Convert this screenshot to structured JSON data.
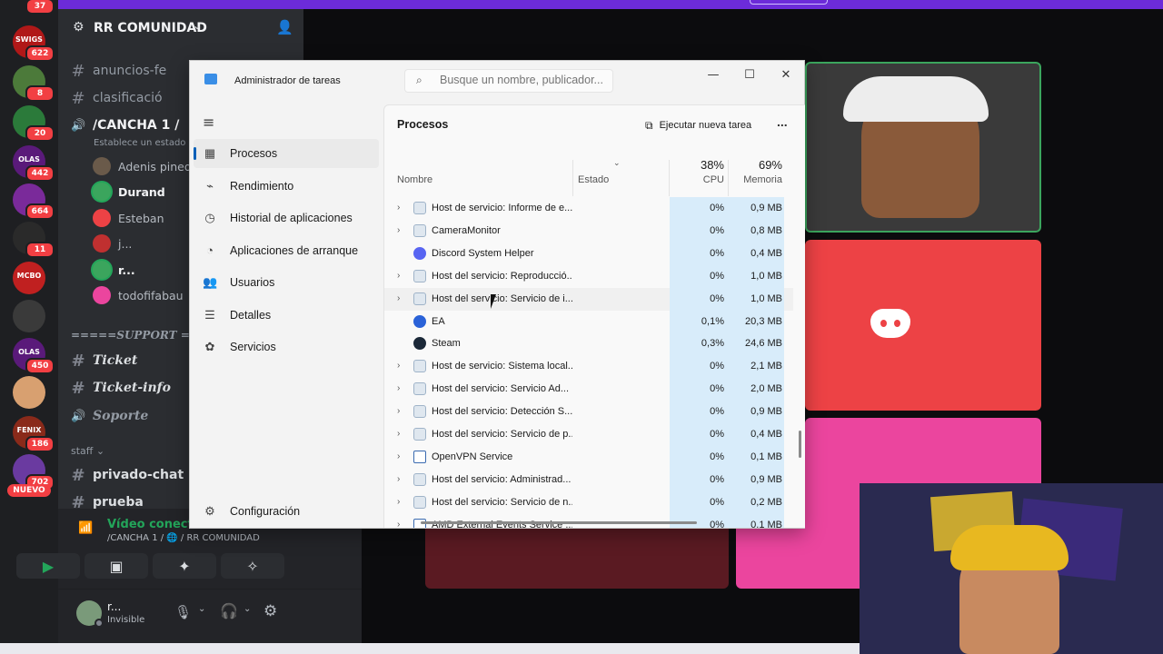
{
  "rail": {
    "top_badge": "37",
    "servers": [
      {
        "label": "SWIGS",
        "badge": "622",
        "color": "#b01818"
      },
      {
        "label": "",
        "badge": "8",
        "color": "#4c7a3a"
      },
      {
        "label": "",
        "badge": "20",
        "color": "#2b7a3a"
      },
      {
        "label": "OLAS",
        "badge": "442",
        "color": "#5a1a7a"
      },
      {
        "label": "",
        "badge": "664",
        "color": "#7a2a9a"
      },
      {
        "label": "",
        "badge": "11",
        "color": "#2a2a2a"
      },
      {
        "label": "MCBO",
        "badge": "",
        "color": "#c02020"
      },
      {
        "label": "",
        "badge": "",
        "color": "#3a3a3a"
      },
      {
        "label": "OLAS",
        "badge": "450",
        "color": "#5a1a7a"
      },
      {
        "label": "",
        "badge": "",
        "color": "#d8a070"
      },
      {
        "label": "FENIX",
        "badge": "186",
        "color": "#8a2a1a"
      },
      {
        "label": "",
        "badge": "702",
        "color": "#6a3aa0"
      }
    ],
    "nuevo": "NUEVO"
  },
  "sidebar": {
    "server_name": "RR COMUNIDAD",
    "channels": [
      {
        "icon": "#",
        "label": "anuncios-fe"
      },
      {
        "icon": "#",
        "label": "clasificació"
      },
      {
        "icon": "🔊",
        "label": "/CANCHA 1 /"
      }
    ],
    "voice_status": "Establece un estado de",
    "voice_users": [
      {
        "name": "Adenis pineda",
        "color": "#6a5a4a"
      },
      {
        "name": "Durand",
        "color": "#3ba55d"
      },
      {
        "name": "Esteban",
        "color": "#ed4245"
      },
      {
        "name": "j...",
        "color": "#c03030"
      },
      {
        "name": "r...",
        "color": "#3ba55d"
      },
      {
        "name": "todofifabau",
        "color": "#eb459e"
      }
    ],
    "category_support": "=====SUPPORT ==",
    "support_channels": [
      {
        "icon": "#",
        "label": "Ticket"
      },
      {
        "icon": "#",
        "label": "Ticket-info"
      },
      {
        "icon": "🔊",
        "label": "Soporte"
      }
    ],
    "category_staff": "staff",
    "staff_channels": [
      {
        "icon": "#",
        "label": "privado-chat"
      },
      {
        "icon": "#",
        "label": "prueba"
      }
    ],
    "rtc_status": "Vídeo conectado",
    "rtc_channel": "/CANCHA 1 / 🌐 / RR COMUNIDAD",
    "user_name": "r...",
    "user_status": "Invisible"
  },
  "taskmanager": {
    "title": "Administrador de tareas",
    "search_placeholder": "Busque un nombre, publicador...",
    "nav": [
      {
        "icon": "grid-icon",
        "label": "Procesos",
        "active": true
      },
      {
        "icon": "pulse-icon",
        "label": "Rendimiento"
      },
      {
        "icon": "history-icon",
        "label": "Historial de aplicaciones"
      },
      {
        "icon": "speedometer-icon",
        "label": "Aplicaciones de arranque"
      },
      {
        "icon": "users-icon",
        "label": "Usuarios"
      },
      {
        "icon": "list-icon",
        "label": "Detalles"
      },
      {
        "icon": "puzzle-icon",
        "label": "Servicios"
      }
    ],
    "settings_label": "Configuración",
    "page_title": "Procesos",
    "run_task": "Ejecutar nueva tarea",
    "more": "...",
    "columns": {
      "name": "Nombre",
      "status": "Estado",
      "cpu_pct": "38%",
      "cpu": "CPU",
      "mem_pct": "69%",
      "mem": "Memoria"
    },
    "rows": [
      {
        "expand": true,
        "icon": "gear-icon",
        "name": "Host de servicio: Informe de e...",
        "cpu": "0%",
        "mem": "0,9 MB"
      },
      {
        "expand": true,
        "icon": "gear-icon",
        "name": "CameraMonitor",
        "cpu": "0%",
        "mem": "0,8 MB"
      },
      {
        "expand": false,
        "icon": "discord-icon",
        "name": "Discord System Helper",
        "cpu": "0%",
        "mem": "0,4 MB"
      },
      {
        "expand": true,
        "icon": "gear-icon",
        "name": "Host del servicio: Reproducció...",
        "cpu": "0%",
        "mem": "1,0 MB"
      },
      {
        "expand": true,
        "icon": "gear-icon",
        "name": "Host del servicio: Servicio de i...",
        "cpu": "0%",
        "mem": "1,0 MB"
      },
      {
        "expand": false,
        "icon": "ea-icon",
        "name": "EA",
        "cpu": "0,1%",
        "mem": "20,3 MB"
      },
      {
        "expand": false,
        "icon": "steam-icon",
        "name": "Steam",
        "cpu": "0,3%",
        "mem": "24,6 MB"
      },
      {
        "expand": true,
        "icon": "gear-icon",
        "name": "Host de servicio: Sistema local...",
        "cpu": "0%",
        "mem": "2,1 MB"
      },
      {
        "expand": true,
        "icon": "gear-icon",
        "name": "Host del servicio: Servicio Ad...",
        "cpu": "0%",
        "mem": "2,0 MB"
      },
      {
        "expand": true,
        "icon": "gear-icon",
        "name": "Host del servicio: Detección S...",
        "cpu": "0%",
        "mem": "0,9 MB"
      },
      {
        "expand": true,
        "icon": "gear-icon",
        "name": "Host del servicio: Servicio de p...",
        "cpu": "0%",
        "mem": "0,4 MB"
      },
      {
        "expand": true,
        "icon": "window-icon",
        "name": "OpenVPN Service",
        "cpu": "0%",
        "mem": "0,1 MB"
      },
      {
        "expand": true,
        "icon": "gear-icon",
        "name": "Host del servicio: Administrad...",
        "cpu": "0%",
        "mem": "0,9 MB"
      },
      {
        "expand": true,
        "icon": "gear-icon",
        "name": "Host del servicio: Servicio de n...",
        "cpu": "0%",
        "mem": "0,2 MB"
      },
      {
        "expand": true,
        "icon": "window-icon",
        "name": "AMD External Events Service ...",
        "cpu": "0%",
        "mem": "0,1 MB"
      }
    ]
  },
  "colors": {
    "discord_blurple": "#5865f2",
    "tile_red": "#ed4245",
    "tile_pink": "#eb459e",
    "speaking_green": "#3ba55d",
    "purple_bar": "#6c2bd9"
  }
}
